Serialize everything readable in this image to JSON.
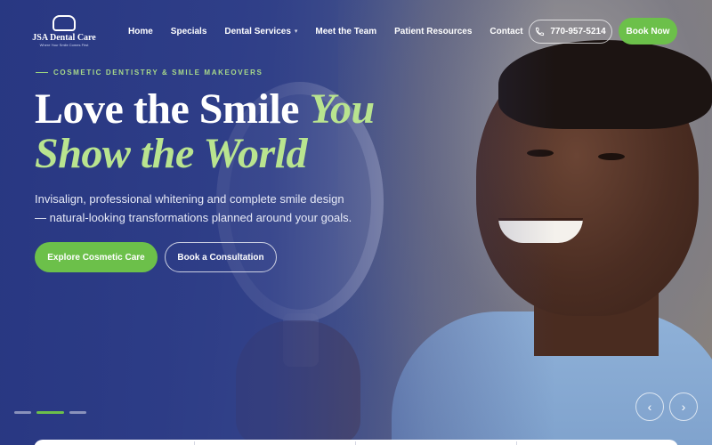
{
  "brand": {
    "name": "JSA Dental Care",
    "tagline": "Where Your Smile Comes First"
  },
  "nav": {
    "items": [
      {
        "label": "Home"
      },
      {
        "label": "Specials"
      },
      {
        "label": "Dental Services",
        "has_dropdown": true
      },
      {
        "label": "Meet the Team"
      },
      {
        "label": "Patient Resources"
      },
      {
        "label": "Contact"
      }
    ],
    "phone": "770-957-5214",
    "book_label": "Book Now"
  },
  "hero": {
    "eyebrow": "COSMETIC DENTISTRY & SMILE MAKEOVERS",
    "headline_plain": "Love the Smile",
    "headline_accent": "You Show the World",
    "subtext": "Invisalign, professional whitening and complete smile design — natural-looking transformations planned around your goals.",
    "primary_cta": "Explore Cosmetic Care",
    "secondary_cta": "Book a Consultation"
  },
  "slider": {
    "slide_count": 3,
    "active_index": 1,
    "prev_icon": "chevron-left-icon",
    "next_icon": "chevron-right-icon"
  },
  "colors": {
    "accent": "#6cc04a",
    "accent_text": "#b9e48f",
    "overlay": "#2e3f86"
  }
}
